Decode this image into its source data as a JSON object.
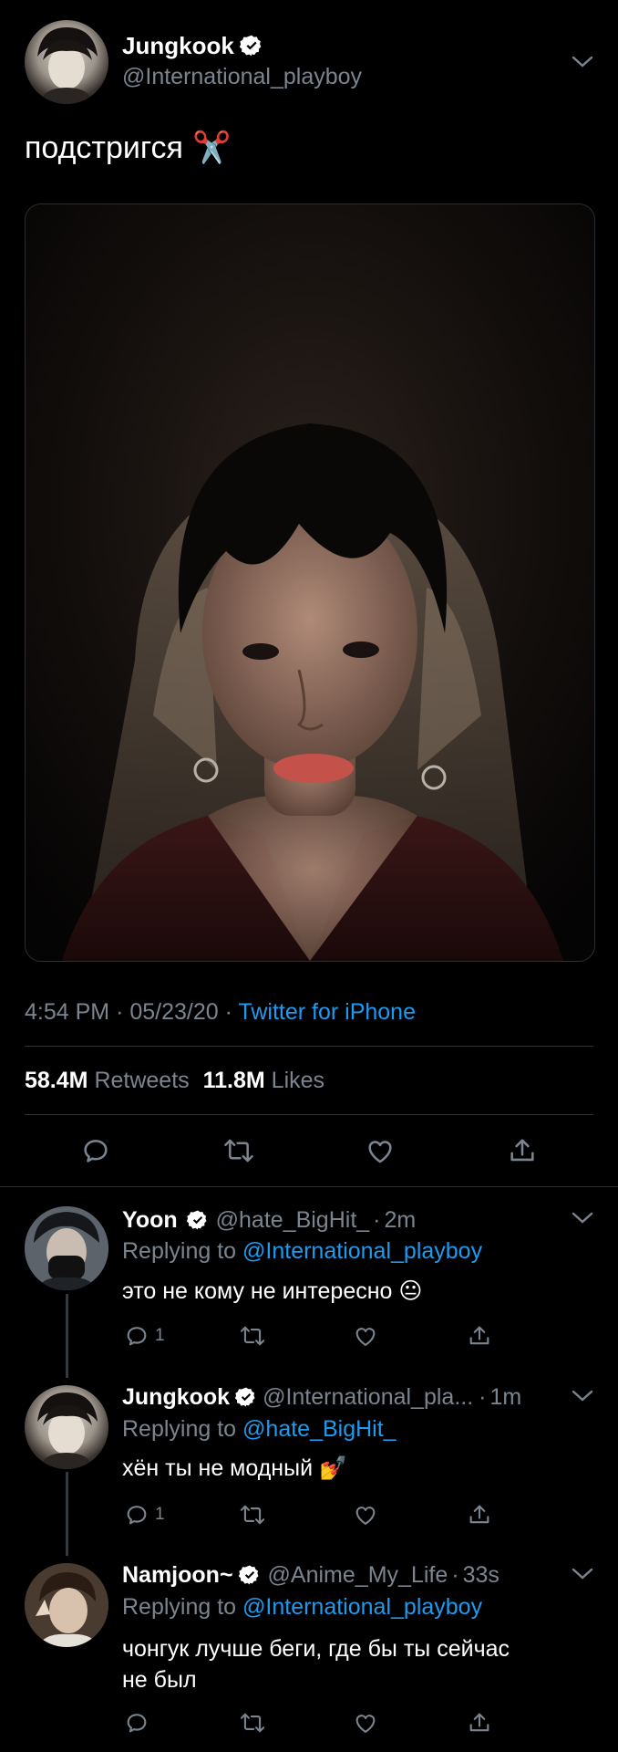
{
  "main": {
    "author": {
      "name": "Jungkook",
      "handle": "@International_playboy"
    },
    "text": "подстригся",
    "emoji": "✂️",
    "meta": {
      "time": "4:54 PM",
      "sep1": "·",
      "date": "05/23/20",
      "sep2": "·",
      "source": "Twitter for iPhone"
    },
    "stats": {
      "retweets_count": "58.4M",
      "retweets_label": "Retweets",
      "likes_count": "11.8M",
      "likes_label": "Likes"
    }
  },
  "replies": [
    {
      "name": "Yoon",
      "handle": "@hate_BigHit_",
      "dot": "·",
      "time": "2m",
      "replying_label": "Replying to",
      "replying_to": "@International_playboy",
      "text": "это не кому не интересно",
      "emoji": "😐",
      "reply_count": "1"
    },
    {
      "name": "Jungkook",
      "handle": "@International_pla...",
      "dot": "·",
      "time": "1m",
      "replying_label": "Replying to",
      "replying_to": "@hate_BigHit_",
      "text": "хён ты не модный",
      "emoji": "💅",
      "reply_count": "1"
    },
    {
      "name": "Namjoon~",
      "handle": "@Anime_My_Life",
      "dot": "·",
      "time": "33s",
      "replying_label": "Replying to",
      "replying_to": "@International_playboy",
      "text_line1": "чонгук лучше беги, где бы ты сейчас",
      "text_line2": "не был"
    }
  ],
  "colors": {
    "accent": "#1d9bf0",
    "muted": "#7b858f",
    "divider": "#2b2f33",
    "background": "#000000"
  }
}
